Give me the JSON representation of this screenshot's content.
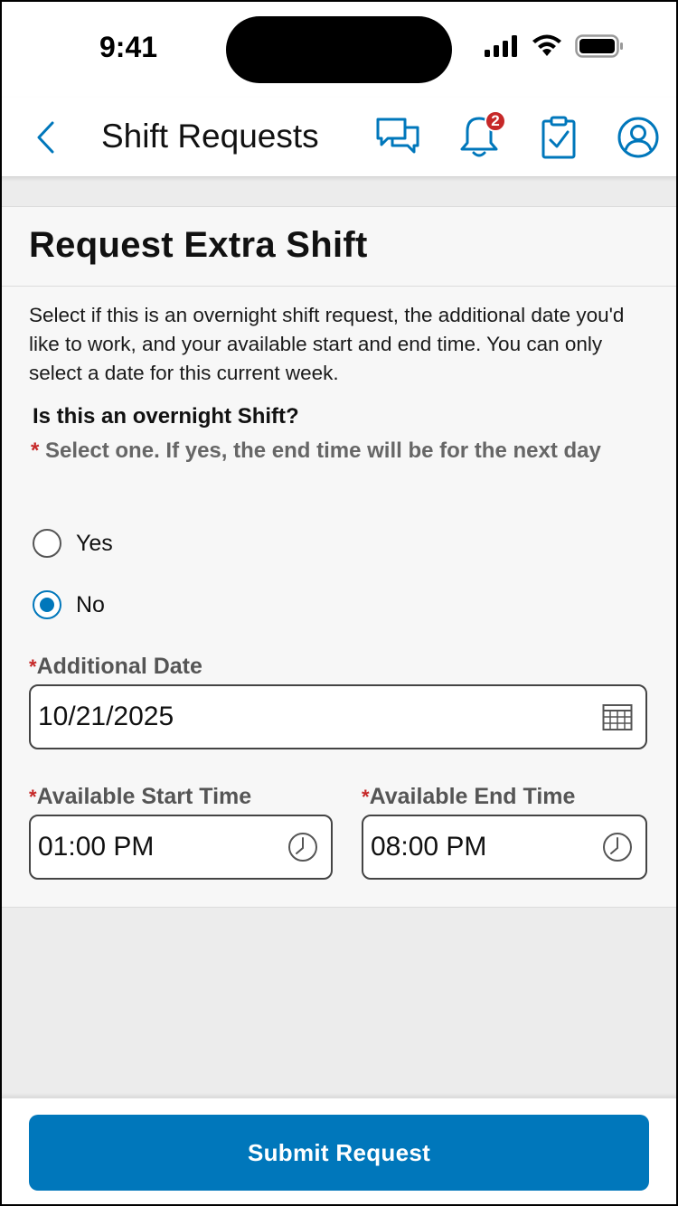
{
  "status_bar": {
    "time": "9:41"
  },
  "nav": {
    "title": "Shift Requests",
    "notification_count": "2",
    "icons": [
      "back-chevron-icon",
      "chat-icon",
      "bell-icon",
      "clipboard-check-icon",
      "user-icon"
    ],
    "accent_color": "#0077bb"
  },
  "card": {
    "title": "Request Extra Shift",
    "intro": "Select if this is an overnight shift request, the additional date you'd like to work, and your available start and end time. You can only select a date for this current week.",
    "question": "Is this an overnight Shift?",
    "required_mark": "*",
    "hint": "Select one. If yes, the end time will be for the next day",
    "options": [
      {
        "label": "Yes",
        "selected": false
      },
      {
        "label": "No",
        "selected": true
      }
    ],
    "date_field": {
      "label": "Additional Date",
      "value": "10/21/2025"
    },
    "start_field": {
      "label": "Available Start Time",
      "value": "01:00 PM"
    },
    "end_field": {
      "label": "Available End Time",
      "value": "08:00 PM"
    }
  },
  "footer": {
    "submit_label": "Submit Request"
  }
}
